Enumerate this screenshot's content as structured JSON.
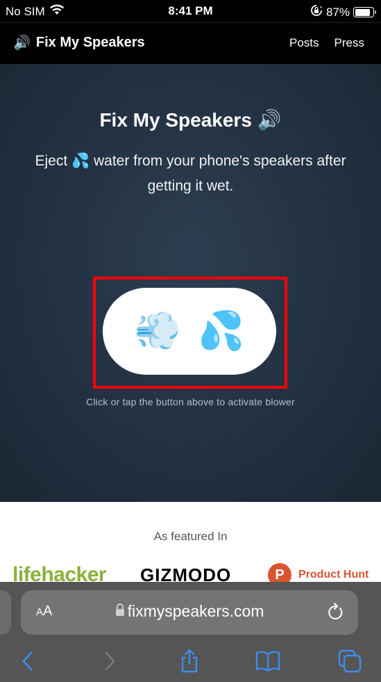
{
  "status_bar": {
    "carrier": "No SIM",
    "time": "8:41 PM",
    "battery_percent": "87%",
    "battery_level": 0.87
  },
  "site_nav": {
    "brand_icon": "🔊",
    "brand": "Fix My Speakers",
    "links": [
      "Posts",
      "Press"
    ]
  },
  "hero": {
    "title": "Fix My Speakers",
    "title_icon": "🔊",
    "subtitle_before": "Eject",
    "subtitle_icon": "💦",
    "subtitle_after": "water from your phone's speakers after getting it wet.",
    "button_icons": [
      "💨",
      "💦"
    ],
    "hint": "Click or tap the button above to activate blower"
  },
  "featured": {
    "label": "As featured In",
    "logos": [
      "lifehacker",
      "GIZMODO",
      "Product Hunt"
    ],
    "ph_letter": "P"
  },
  "browser": {
    "aa_label_small": "A",
    "aa_label_large": "A",
    "url": "fixmyspeakers.com",
    "accent_color": "#3d8ef0",
    "disabled_color": "#7a7a7a"
  }
}
